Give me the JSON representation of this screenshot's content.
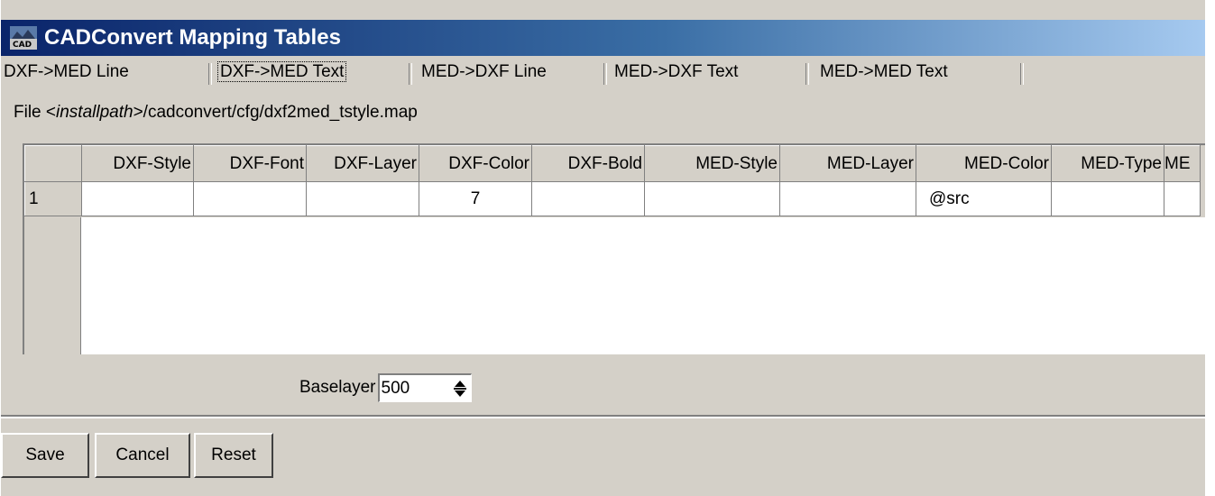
{
  "window": {
    "title": "CADConvert Mapping Tables"
  },
  "tabs": [
    {
      "label": "DXF->MED Line"
    },
    {
      "label": "DXF->MED Text",
      "active": true
    },
    {
      "label": "MED->DXF Line"
    },
    {
      "label": "MED->DXF Text"
    },
    {
      "label": "MED->MED Text"
    }
  ],
  "file": {
    "prefix": "File ",
    "lt": "<",
    "placeholder": "installpath",
    "rest": ">/cadconvert/cfg/dxf2med_tstyle.map"
  },
  "table": {
    "columns": [
      "",
      "DXF-Style",
      "DXF-Font",
      "DXF-Layer",
      "DXF-Color",
      "DXF-Bold",
      "MED-Style",
      "MED-Layer",
      "MED-Color",
      "MED-Type",
      "ME"
    ],
    "rows": [
      [
        "1",
        "",
        "",
        "",
        "7",
        "",
        "",
        "",
        "@src",
        "",
        ""
      ]
    ]
  },
  "baselayer": {
    "label": "Baselayer",
    "value": "500"
  },
  "buttons": {
    "save": "Save",
    "cancel": "Cancel",
    "reset": "Reset"
  }
}
